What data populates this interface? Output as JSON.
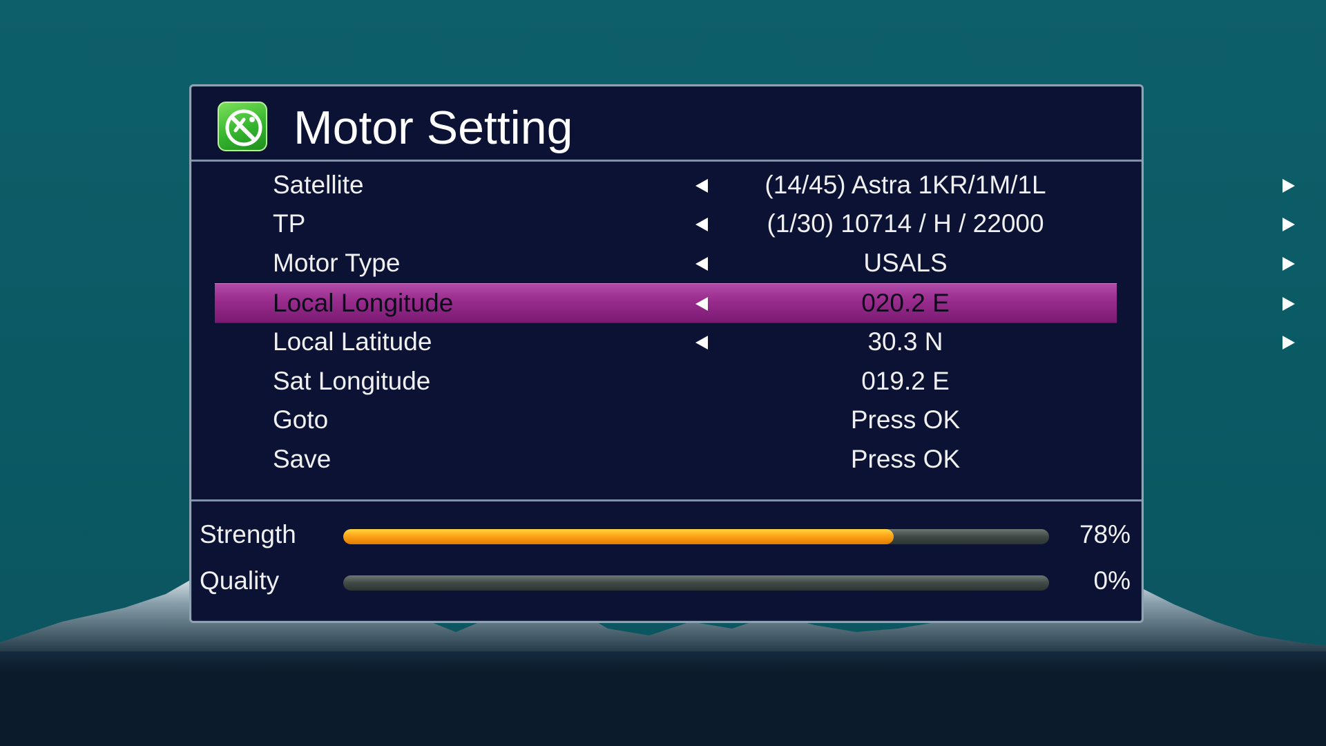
{
  "screen": {
    "title": "Motor Setting",
    "logo_icon": "satellite-dish-icon",
    "accent_color": "#9b2d8f",
    "panel_color": "#0b1233",
    "background_color": "#0a5c66"
  },
  "settings": [
    {
      "label": "Satellite",
      "value": "(14/45) Astra 1KR/1M/1L",
      "arrows": true,
      "selected": false
    },
    {
      "label": "TP",
      "value": "(1/30) 10714 / H / 22000",
      "arrows": true,
      "selected": false
    },
    {
      "label": "Motor Type",
      "value": "USALS",
      "arrows": true,
      "selected": false
    },
    {
      "label": "Local Longitude",
      "value": "020.2 E",
      "arrows": true,
      "selected": true
    },
    {
      "label": "Local Latitude",
      "value": "30.3 N",
      "arrows": true,
      "selected": false
    },
    {
      "label": "Sat Longitude",
      "value": "019.2 E",
      "arrows": false,
      "selected": false
    },
    {
      "label": "Goto",
      "value": "Press OK",
      "arrows": false,
      "selected": false
    },
    {
      "label": "Save",
      "value": "Press OK",
      "arrows": false,
      "selected": false
    }
  ],
  "signal": {
    "strength": {
      "label": "Strength",
      "percent_text": "78%",
      "level": 0.78,
      "color": "#ffa41a"
    },
    "quality": {
      "label": "Quality",
      "percent_text": "0%",
      "level": 0.0,
      "color": "#ffa41a"
    }
  }
}
